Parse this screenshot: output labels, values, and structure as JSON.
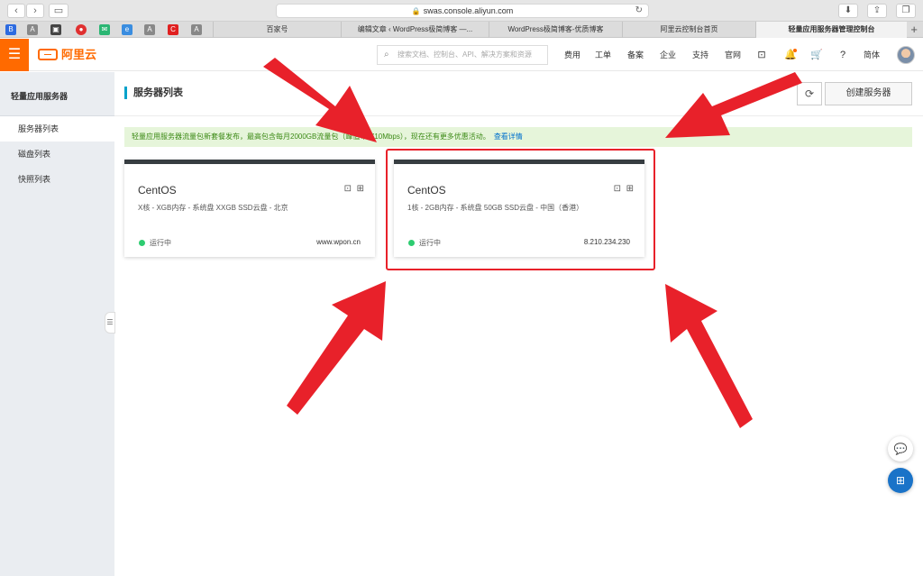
{
  "browser": {
    "url": "swas.console.aliyun.com",
    "tabs": [
      {
        "label": "百家号",
        "active": false
      },
      {
        "label": "编辑文章 ‹ WordPress极简博客 —...",
        "active": false
      },
      {
        "label": "WordPress极简博客-优质博客",
        "active": false
      },
      {
        "label": "阿里云控制台首页",
        "active": false
      },
      {
        "label": "轻量应用服务器管理控制台",
        "active": true
      }
    ]
  },
  "header": {
    "logo": "阿里云",
    "search_placeholder": "搜索文档、控制台、API、解决方案和资源",
    "nav": [
      "费用",
      "工单",
      "备案",
      "企业",
      "支持",
      "官网"
    ],
    "lang": "简体",
    "accent": "#ff6a00"
  },
  "sidebar": {
    "title": "轻量应用服务器",
    "items": [
      {
        "label": "服务器列表",
        "active": true
      },
      {
        "label": "磁盘列表",
        "active": false
      },
      {
        "label": "快照列表",
        "active": false
      }
    ]
  },
  "main": {
    "title": "服务器列表",
    "create_button": "创建服务器",
    "promo": {
      "text": "轻量应用服务器流量包新套餐发布，最高包含每月2000GB流量包（峰值带宽10Mbps），现在还有更多优惠活动。",
      "link": "查看详情"
    },
    "servers": [
      {
        "os": "CentOS",
        "spec": "X核 - XGB内存 - 系统盘 XXGB SSD云盘 - 北京",
        "status": "运行中",
        "address": "www.wpon.cn"
      },
      {
        "os": "CentOS",
        "spec": "1核 - 2GB内存 - 系统盘 50GB SSD云盘 - 中国（香港）",
        "status": "运行中",
        "address": "8.210.234.230"
      }
    ]
  },
  "annotation": {
    "color": "#e8212a"
  }
}
